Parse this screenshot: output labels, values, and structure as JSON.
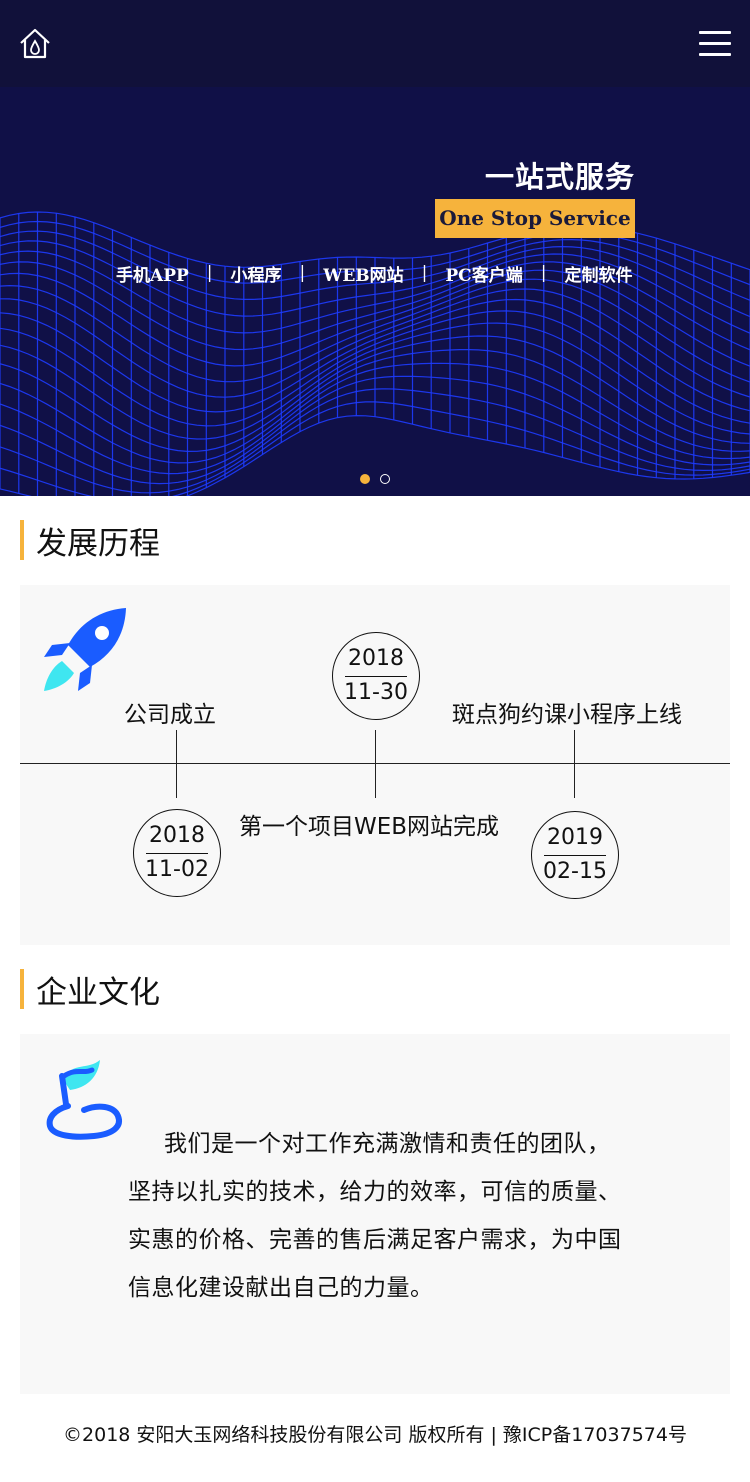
{
  "header": {
    "home_icon": "home-icon",
    "menu_icon": "hamburger-menu-icon"
  },
  "banner": {
    "title": "一站式服务",
    "badge": "One Stop Service",
    "links": [
      "手机APP",
      "小程序",
      "WEB网站",
      "PC客户端",
      "定制软件"
    ],
    "separator": "|",
    "slides_total": 2,
    "active_slide": 1,
    "colors": {
      "background": "#101047",
      "accent": "#f6b33c",
      "grid": "#1e3cff"
    }
  },
  "history": {
    "title": "发展历程",
    "icon": "rocket-icon",
    "milestones": [
      {
        "year": "2018",
        "date": "11-02",
        "event": "公司成立"
      },
      {
        "year": "2018",
        "date": "11-30",
        "event": "第一个项目WEB网站完成"
      },
      {
        "year": "2019",
        "date": "02-15",
        "event": "斑点狗约课小程序上线"
      }
    ]
  },
  "culture": {
    "title": "企业文化",
    "icon": "flag-icon",
    "text": "我们是一个对工作充满激情和责任的团队，坚持以扎实的技术，给力的效率，可信的质量、实惠的价格、完善的售后满足客户需求，为中国信息化建设献出自己的力量。"
  },
  "footer": {
    "text": "©2018 安阳大玉网络科技股份有限公司 版权所有 | 豫ICP备17037574号"
  }
}
